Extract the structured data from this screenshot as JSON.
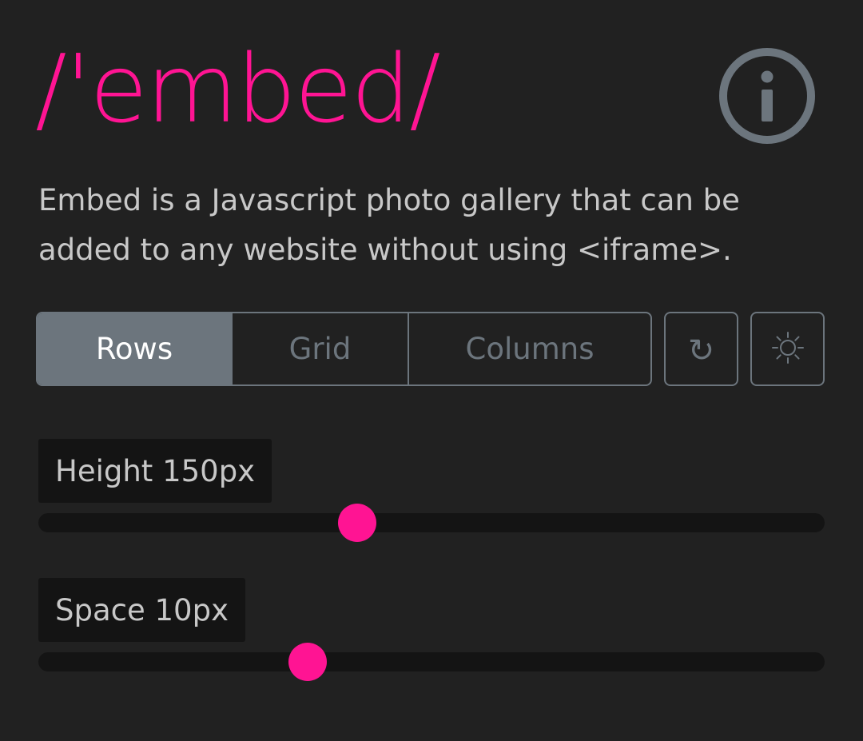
{
  "app": {
    "logo_text": "/'embed/",
    "description": "Embed is a Javascript photo gallery that can be added to any website without using <iframe>."
  },
  "colors": {
    "accent": "#ff1493",
    "background": "#212121",
    "muted": "#6c757d",
    "control_bg": "#141414",
    "text": "#c8c8c8"
  },
  "header": {
    "info_icon": "info-circle-icon"
  },
  "layout_modes": {
    "selected": "Rows",
    "options": [
      {
        "label": "Rows",
        "active": true
      },
      {
        "label": "Grid",
        "active": false
      },
      {
        "label": "Columns",
        "active": false
      }
    ]
  },
  "toolbar": {
    "refresh_icon": "refresh-icon",
    "theme_icon": "sun-icon"
  },
  "controls": {
    "height": {
      "label": "Height 150px",
      "value_fraction": 0.405
    },
    "space": {
      "label": "Space 10px",
      "value_fraction": 0.342
    }
  }
}
